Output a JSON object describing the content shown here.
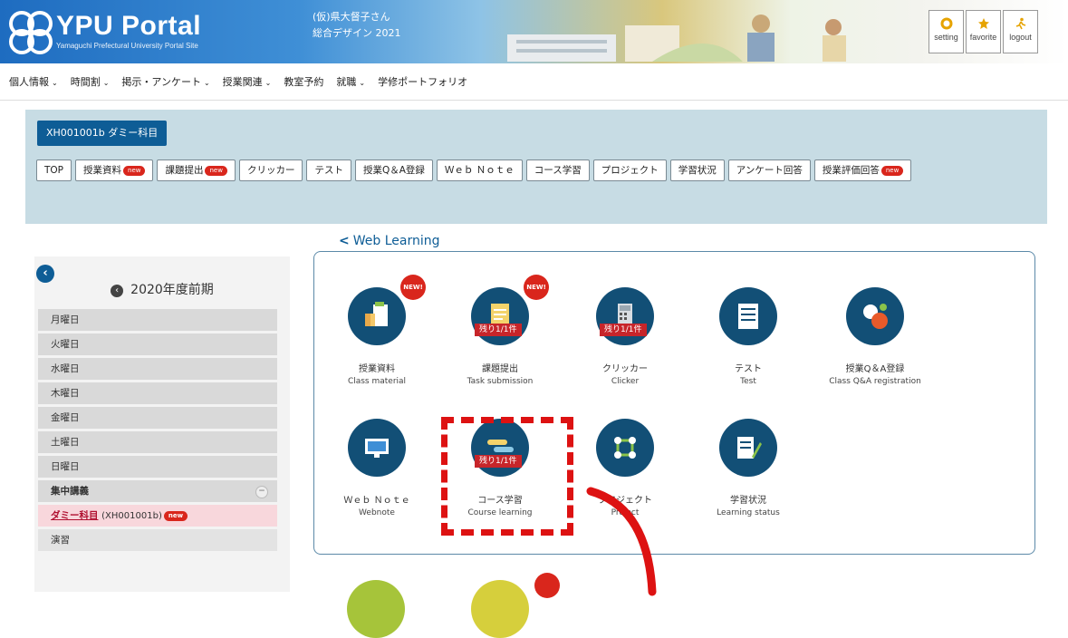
{
  "header": {
    "logo_title": "YPU Portal",
    "logo_subtitle": "Yamaguchi Prefectural University Portal Site",
    "greeting_line1": "(仮)県大督子さん",
    "greeting_line2": "総合デザイン 2021",
    "buttons": [
      {
        "label": "setting",
        "icon": "gear-icon",
        "color": "#e6a300"
      },
      {
        "label": "favorite",
        "icon": "star-icon",
        "color": "#e6a300"
      },
      {
        "label": "logout",
        "icon": "runner-icon",
        "color": "#e6a300"
      }
    ]
  },
  "nav": {
    "items": [
      {
        "label": "個人情報",
        "dropdown": true
      },
      {
        "label": "時間割",
        "dropdown": true
      },
      {
        "label": "掲示・アンケート",
        "dropdown": true
      },
      {
        "label": "授業関連",
        "dropdown": true
      },
      {
        "label": "教室予約",
        "dropdown": false
      },
      {
        "label": "就職",
        "dropdown": true
      },
      {
        "label": "学修ポートフォリオ",
        "dropdown": false
      }
    ]
  },
  "course": {
    "tag": "XH001001b ダミー科目",
    "tabs": [
      {
        "label": "TOP",
        "new": false
      },
      {
        "label": "授業資料",
        "new": true
      },
      {
        "label": "課題提出",
        "new": true
      },
      {
        "label": "クリッカー",
        "new": false
      },
      {
        "label": "テスト",
        "new": false
      },
      {
        "label": "授業Q＆A登録",
        "new": false
      },
      {
        "label": "Ｗｅｂ Ｎｏｔｅ",
        "new": false
      },
      {
        "label": "コース学習",
        "new": false
      },
      {
        "label": "プロジェクト",
        "new": false
      },
      {
        "label": "学習状況",
        "new": false
      },
      {
        "label": "アンケート回答",
        "new": false
      },
      {
        "label": "授業評価回答",
        "new": true
      }
    ],
    "new_badge": "new"
  },
  "sidebar": {
    "term": "2020年度前期",
    "days": [
      "月曜日",
      "火曜日",
      "水曜日",
      "木曜日",
      "金曜日",
      "土曜日",
      "日曜日"
    ],
    "intensive": "集中講義",
    "active_course": "ダミー科目",
    "active_code": "(XH001001b)",
    "next_item": "演習"
  },
  "web_learning": {
    "title": "Web Learning",
    "new_label": "NEW!",
    "tiles": [
      {
        "jp": "授業資料",
        "en": "Class material",
        "icon": "document-icon",
        "new": true,
        "remaining": ""
      },
      {
        "jp": "課題提出",
        "en": "Task submission",
        "icon": "clipboard-icon",
        "new": true,
        "remaining": "残り1/1件"
      },
      {
        "jp": "クリッカー",
        "en": "Clicker",
        "icon": "calculator-icon",
        "new": false,
        "remaining": "残り1/1件"
      },
      {
        "jp": "テスト",
        "en": "Test",
        "icon": "test-sheet-icon",
        "new": false,
        "remaining": ""
      },
      {
        "jp": "授業Q＆A登録",
        "en": "Class Q&A registration",
        "icon": "qa-icon",
        "new": false,
        "remaining": ""
      },
      {
        "jp": "Ｗｅｂ Ｎｏｔｅ",
        "en": "Webnote",
        "icon": "monitor-icon",
        "new": false,
        "remaining": ""
      },
      {
        "jp": "コース学習",
        "en": "Course learning",
        "icon": "course-icon",
        "new": false,
        "remaining": "残り1/1件"
      },
      {
        "jp": "プロジェクト",
        "en": "Project",
        "icon": "project-icon",
        "new": false,
        "remaining": ""
      },
      {
        "jp": "学習状況",
        "en": "Learning status",
        "icon": "status-report-icon",
        "new": false,
        "remaining": ""
      }
    ]
  },
  "colors": {
    "navy": "#124f76",
    "accent_red": "#d9261c",
    "panel": "#c7dce4",
    "highlight": "#dd1212"
  }
}
